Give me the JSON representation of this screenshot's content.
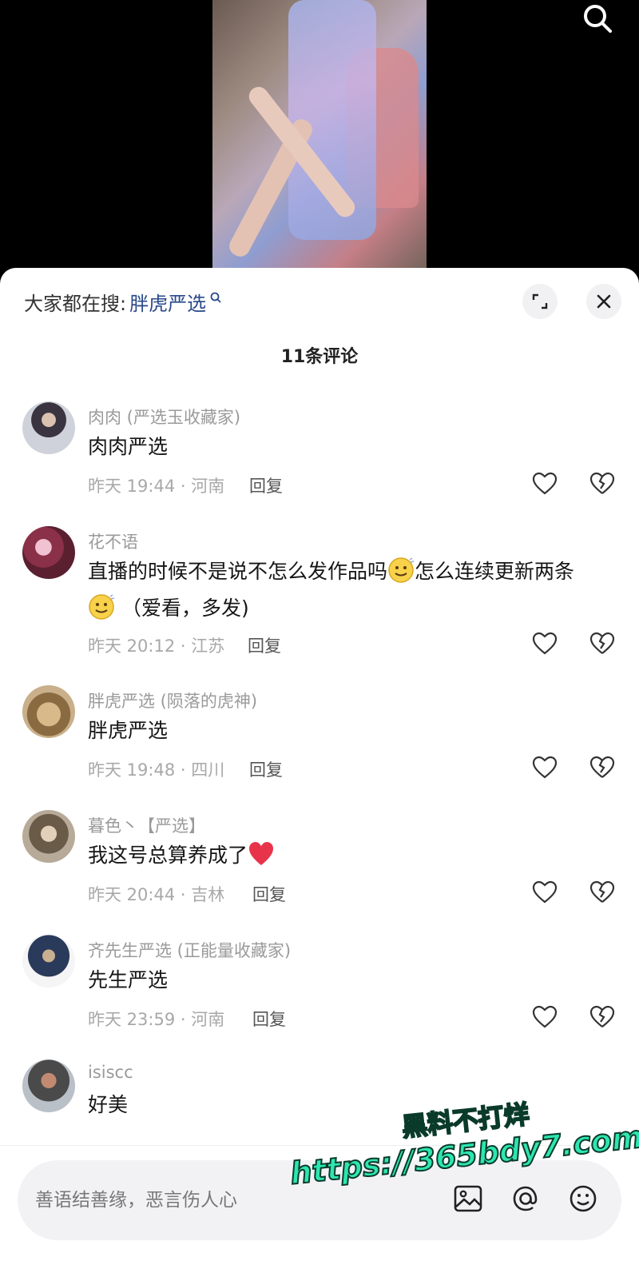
{
  "hot_search": {
    "prefix": "大家都在搜:",
    "keyword": "胖虎严选"
  },
  "comment_count_title": "11条评论",
  "comments": [
    {
      "user": "肉肉 (严选玉收藏家)",
      "text": "肉肉严选",
      "time_location": "昨天 19:44 · 河南",
      "reply": "回复"
    },
    {
      "user": "花不语",
      "text_part1": "直播的时候不是说不怎么发作品吗",
      "text_part2": "怎么连续更新两条",
      "text_part3": "（爱看，多发)",
      "time_location": "昨天 20:12 · 江苏",
      "reply": "回复"
    },
    {
      "user": "胖虎严选 (陨落的虎神)",
      "text": "胖虎严选",
      "time_location": "昨天 19:48 · 四川",
      "reply": "回复"
    },
    {
      "user": "暮色丶【严选】",
      "text": "我这号总算养成了",
      "time_location": "昨天 20:44 · 吉林",
      "reply": "回复"
    },
    {
      "user": "齐先生严选 (正能量收藏家)",
      "text": "先生严选",
      "time_location": "昨天 23:59 · 河南",
      "reply": "回复"
    },
    {
      "user": "isiscc",
      "text": "好美"
    }
  ],
  "input": {
    "placeholder": "善语结善缘，恶言伤人心"
  },
  "watermark": {
    "line1": "黑料不打烊",
    "line2": "https://365bdy7.com"
  },
  "colors": {
    "keyword": "#2a4a8a",
    "watermark": "#2de6b0",
    "heart_red": "#e8344a"
  },
  "icons": [
    "search-icon",
    "expand-icon",
    "close-icon",
    "heart-icon",
    "broken-heart-icon",
    "image-icon",
    "at-icon",
    "emoji-icon"
  ]
}
